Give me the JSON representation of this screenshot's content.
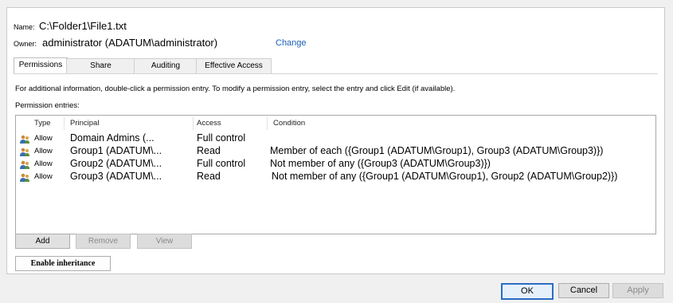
{
  "header": {
    "name_label": "Name:",
    "name_value": "C:\\Folder1\\File1.txt",
    "owner_label": "Owner:",
    "owner_value": "administrator (ADATUM\\administrator)",
    "change_link": "Change"
  },
  "tabs": [
    {
      "label": "Permissions",
      "active": true
    },
    {
      "label": "Share",
      "active": false
    },
    {
      "label": "Auditing",
      "active": false
    },
    {
      "label": "Effective Access",
      "active": false
    }
  ],
  "info_text": "For additional information, double-click a permission entry. To modify a permission entry, select the entry and click Edit (if available).",
  "entries_label": "Permission entries:",
  "columns": {
    "type": "Type",
    "principal": "Principal",
    "access": "Access",
    "condition": "Condition"
  },
  "entries": [
    {
      "icon": "users-icon",
      "type": "Allow",
      "principal": "Domain Admins (...",
      "access": "Full control",
      "condition": ""
    },
    {
      "icon": "users-icon",
      "type": "Allow",
      "principal": "Group1 (ADATUM\\...",
      "access": "Read",
      "condition": "Member of each ({Group1 (ADATUM\\Group1), Group3 (ADATUM\\Group3)})"
    },
    {
      "icon": "users-icon",
      "type": "Allow",
      "principal": "Group2 (ADATUM\\...",
      "access": "Full control",
      "condition": "Not member of any ({Group3 (ADATUM\\Group3)})"
    },
    {
      "icon": "users-icon",
      "type": "Allow",
      "principal": "Group3 (ADATUM\\...",
      "access": "Read",
      "condition": "Not member of any ({Group1 (ADATUM\\Group1), Group2 (ADATUM\\Group2)})"
    }
  ],
  "buttons": {
    "add": "Add",
    "remove": "Remove",
    "view": "View",
    "enable_inheritance": "Enable inheritance",
    "ok": "OK",
    "cancel": "Cancel",
    "apply": "Apply"
  },
  "colors": {
    "link": "#1a5fb4",
    "primary_border": "#2b6cc4"
  }
}
